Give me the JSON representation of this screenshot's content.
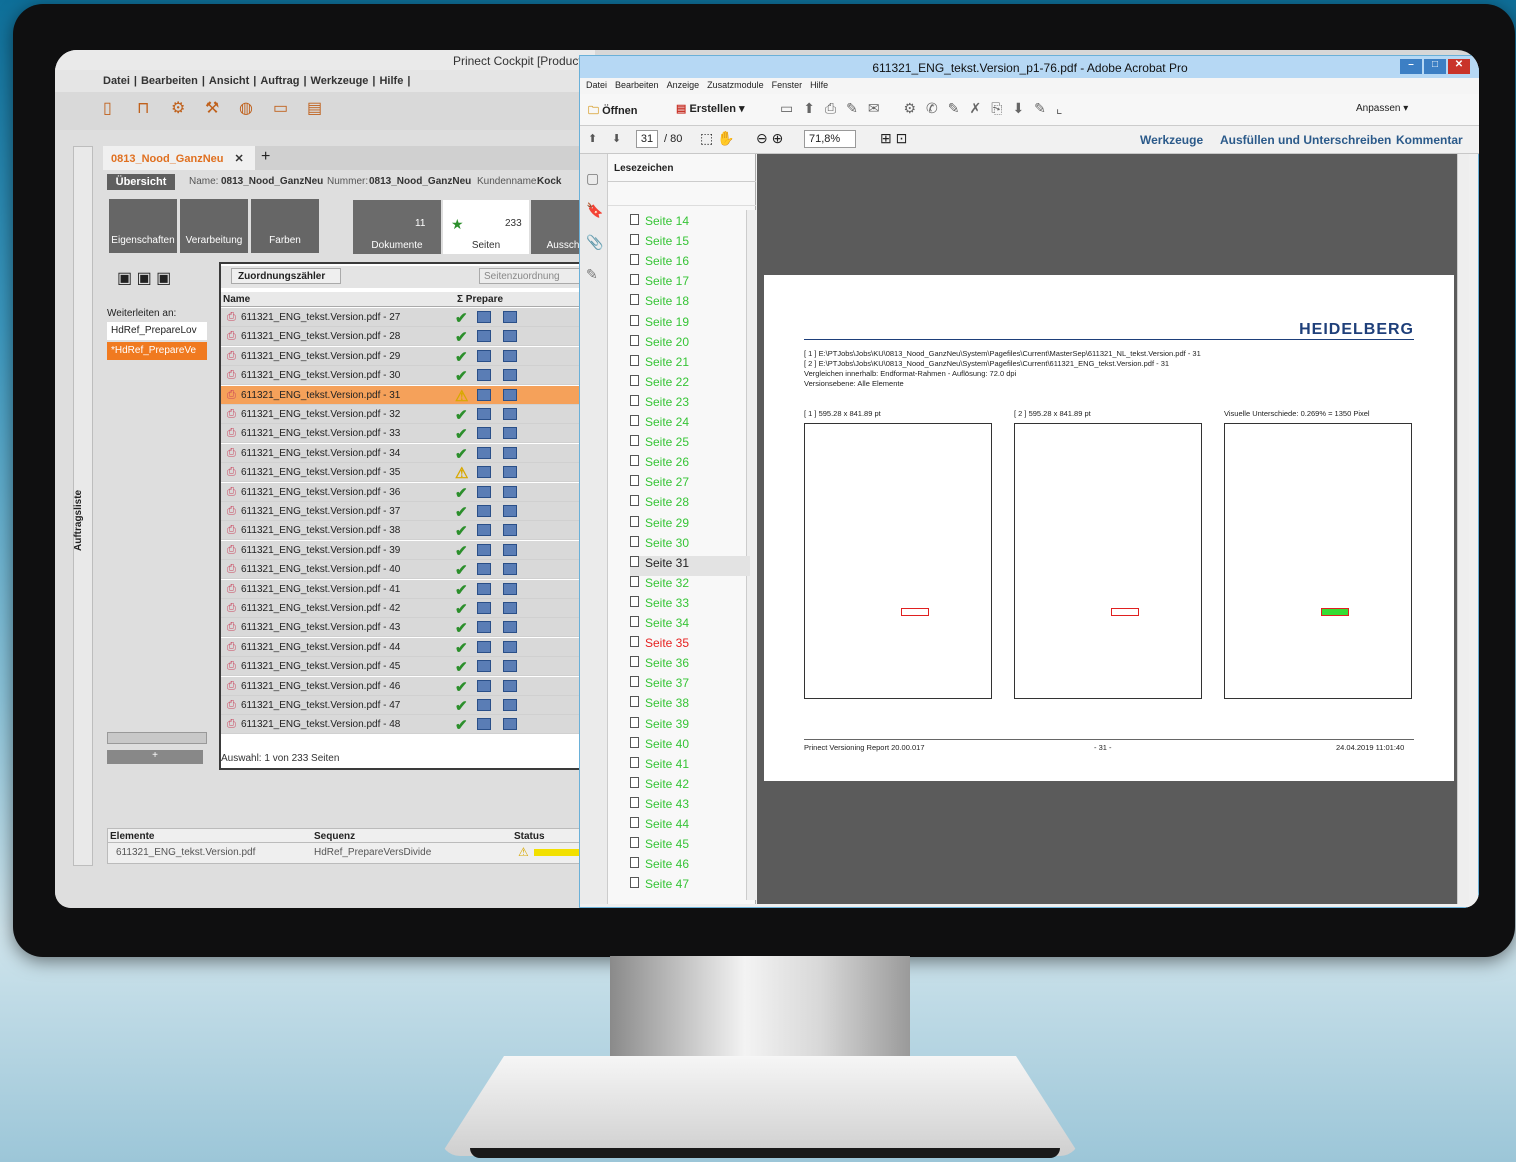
{
  "cockpit": {
    "title": "Prinect Cockpit [Productio",
    "menu": [
      "Datei",
      "|",
      "Bearbeiten",
      "|",
      "Ansicht",
      "|",
      "Auftrag",
      "|",
      "Werkzeuge",
      "|",
      "Hilfe",
      "|"
    ],
    "side_label": "Auftragsliste",
    "job_tab": "0813_Nood_GanzNeu",
    "tab_close": "✕",
    "overview": "Übersicht",
    "name_label": "Name:",
    "name_value": "0813_Nood_GanzNeu",
    "nummer_label": "Nummer:",
    "nummer_value": "0813_Nood_GanzNeu",
    "kunde_label": "Kundenname:",
    "kunde_value": "Kock",
    "buttons": {
      "eigenschaften": "Eigenschaften",
      "verarbeitung": "Verarbeitung",
      "farben": "Farben"
    },
    "flow": {
      "dokumente": "Dokumente",
      "dokumente_count": "11",
      "seiten": "Seiten",
      "seiten_count": "233",
      "ausschiessen": "Aussch"
    },
    "weiterleiten": "Weiterleiten an:",
    "refs": [
      "HdRef_PrepareLov",
      "*HdRef_PrepareVe"
    ],
    "zuordnung": "Zuordnungszähler",
    "seitenzuordnung": "Seitenzuordnung",
    "col_name": "Name",
    "col_prepare": "Σ Prepare",
    "rows": [
      {
        "name": "611321_ENG_tekst.Version.pdf - 27",
        "status": "ok"
      },
      {
        "name": "611321_ENG_tekst.Version.pdf - 28",
        "status": "ok"
      },
      {
        "name": "611321_ENG_tekst.Version.pdf - 29",
        "status": "ok"
      },
      {
        "name": "611321_ENG_tekst.Version.pdf - 30",
        "status": "ok"
      },
      {
        "name": "611321_ENG_tekst.Version.pdf - 31",
        "status": "warn",
        "selected": true
      },
      {
        "name": "611321_ENG_tekst.Version.pdf - 32",
        "status": "ok"
      },
      {
        "name": "611321_ENG_tekst.Version.pdf - 33",
        "status": "ok"
      },
      {
        "name": "611321_ENG_tekst.Version.pdf - 34",
        "status": "ok"
      },
      {
        "name": "611321_ENG_tekst.Version.pdf - 35",
        "status": "warn"
      },
      {
        "name": "611321_ENG_tekst.Version.pdf - 36",
        "status": "ok"
      },
      {
        "name": "611321_ENG_tekst.Version.pdf - 37",
        "status": "ok"
      },
      {
        "name": "611321_ENG_tekst.Version.pdf - 38",
        "status": "ok"
      },
      {
        "name": "611321_ENG_tekst.Version.pdf - 39",
        "status": "ok"
      },
      {
        "name": "611321_ENG_tekst.Version.pdf - 40",
        "status": "ok"
      },
      {
        "name": "611321_ENG_tekst.Version.pdf - 41",
        "status": "ok"
      },
      {
        "name": "611321_ENG_tekst.Version.pdf - 42",
        "status": "ok"
      },
      {
        "name": "611321_ENG_tekst.Version.pdf - 43",
        "status": "ok"
      },
      {
        "name": "611321_ENG_tekst.Version.pdf - 44",
        "status": "ok"
      },
      {
        "name": "611321_ENG_tekst.Version.pdf - 45",
        "status": "ok"
      },
      {
        "name": "611321_ENG_tekst.Version.pdf - 46",
        "status": "ok"
      },
      {
        "name": "611321_ENG_tekst.Version.pdf - 47",
        "status": "ok"
      },
      {
        "name": "611321_ENG_tekst.Version.pdf - 48",
        "status": "ok"
      }
    ],
    "auswahl": "Auswahl:  1 von 233 Seiten",
    "elem_headers": {
      "elemente": "Elemente",
      "sequenz": "Sequenz",
      "status": "Status"
    },
    "elem_row": {
      "element": "611321_ENG_tekst.Version.pdf",
      "sequenz": "HdRef_PrepareVersDivide"
    }
  },
  "acrobat": {
    "title": "611321_ENG_tekst.Version_p1-76.pdf - Adobe Acrobat Pro",
    "menu": [
      "Datei",
      "Bearbeiten",
      "Anzeige",
      "Zusatzmodule",
      "Fenster",
      "Hilfe"
    ],
    "open": "Öffnen",
    "create": "Erstellen",
    "anpassen": "Anpassen",
    "page_current": "31",
    "page_total": "/ 80",
    "zoom": "71,8%",
    "right_tabs": [
      "Werkzeuge",
      "Ausfüllen und Unterschreiben",
      "Kommentar"
    ],
    "bm_title": "Lesezeichen",
    "bookmarks": [
      "Seite 14",
      "Seite 15",
      "Seite 16",
      "Seite 17",
      "Seite 18",
      "Seite 19",
      "Seite 20",
      "Seite 21",
      "Seite 22",
      "Seite 23",
      "Seite 24",
      "Seite 25",
      "Seite 26",
      "Seite 27",
      "Seite 28",
      "Seite 29",
      "Seite 30",
      "Seite 31",
      "Seite 32",
      "Seite 33",
      "Seite 34",
      "Seite 35",
      "Seite 36",
      "Seite 37",
      "Seite 38",
      "Seite 39",
      "Seite 40",
      "Seite 41",
      "Seite 42",
      "Seite 43",
      "Seite 44",
      "Seite 45",
      "Seite 46",
      "Seite 47"
    ],
    "current_bookmark": "Seite 31",
    "red_bookmark": "Seite 35"
  },
  "report": {
    "logo": "HEIDELBERG",
    "line1": "[ 1 ] E:\\PTJobs\\Jobs\\KU\\0813_Nood_GanzNeu\\System\\Pagefiles\\Current\\MasterSep\\611321_NL_tekst.Version.pdf - 31",
    "line2": "[ 2 ] E:\\PTJobs\\Jobs\\KU\\0813_Nood_GanzNeu\\System\\Pagefiles\\Current\\611321_ENG_tekst.Version.pdf - 31",
    "line3": "Vergleichen innerhalb: Endformat-Rahmen - Auflösung: 72.0 dpi",
    "line4": "Versionsebene: Alle Elemente",
    "box1": "[ 1 ] 595.28 x 841.89 pt",
    "box2": "[ 2 ] 595.28 x 841.89 pt",
    "box3": "Visuelle Unterschiede: 0.269%  =  1350 Pixel",
    "footer_left": "Prinect Versioning Report 20.00.017",
    "footer_mid": "- 31 -",
    "footer_right": "24.04.2019 11:01:40"
  }
}
